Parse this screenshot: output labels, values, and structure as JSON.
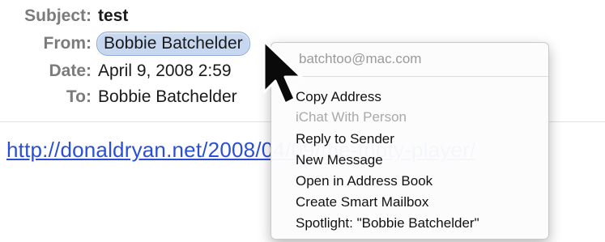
{
  "header": {
    "subject_label": "Subject:",
    "subject_value": "test",
    "from_label": "From:",
    "from_value": "Bobbie Batchelder",
    "date_label": "Date:",
    "date_value": "April 9, 2008 2:59",
    "to_label": "To:",
    "to_value": "Bobbie Batchelder"
  },
  "body": {
    "link_text": "http://donaldryan.net/2008/04/09/the-tooty-player/"
  },
  "context_menu": {
    "email": "batchtoo@mac.com",
    "items": [
      {
        "label": "Copy Address",
        "enabled": true
      },
      {
        "label": "iChat With Person",
        "enabled": false
      },
      {
        "label": "Reply to Sender",
        "enabled": true
      },
      {
        "label": "New Message",
        "enabled": true
      },
      {
        "label": "Open in Address Book",
        "enabled": true
      },
      {
        "label": "Create Smart Mailbox",
        "enabled": true
      },
      {
        "label": "Spotlight: \"Bobbie Batchelder\"",
        "enabled": true
      }
    ]
  },
  "colors": {
    "link": "#2a4fd6",
    "label_gray": "#7b7b7b",
    "pill_fill": "#c7d7f0",
    "pill_border": "#8fa9d6",
    "disabled_text": "#a9a9a9"
  },
  "icons": {
    "cursor": "mouse-pointer-icon"
  }
}
